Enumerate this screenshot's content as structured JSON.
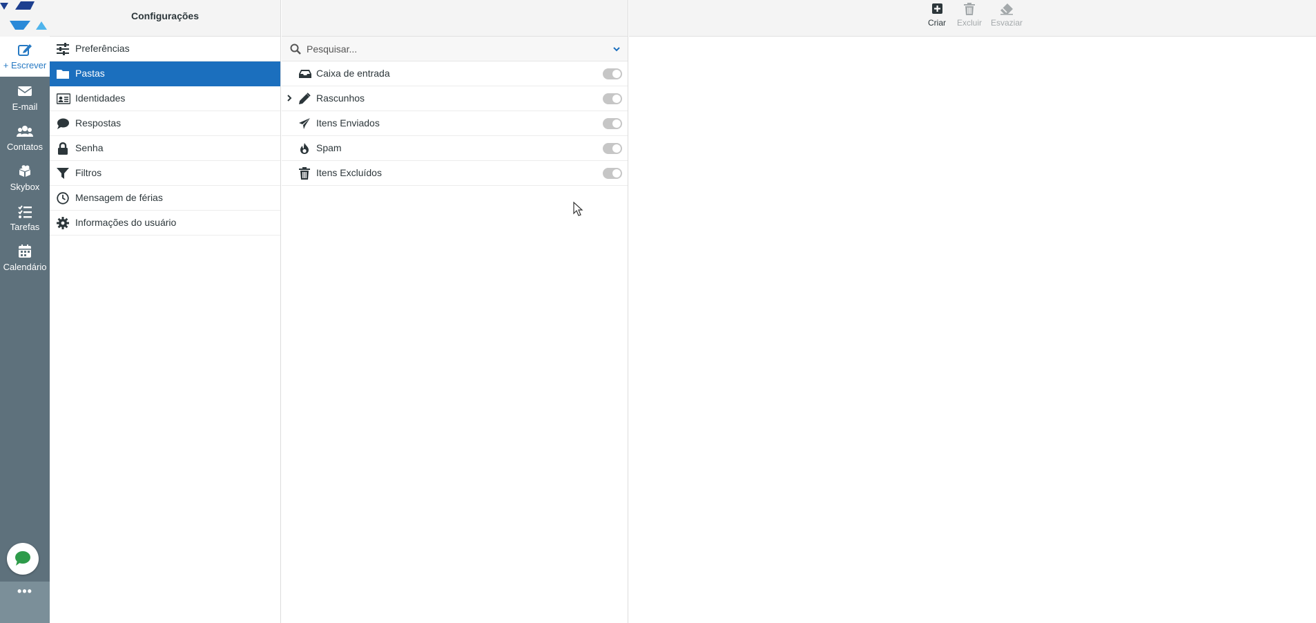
{
  "rail": {
    "items": [
      {
        "label": "+ Escrever",
        "icon": "compose-icon"
      },
      {
        "label": "E-mail",
        "icon": "envelope-icon"
      },
      {
        "label": "Contatos",
        "icon": "users-icon"
      },
      {
        "label": "Skybox",
        "icon": "cloud-box-icon"
      },
      {
        "label": "Tarefas",
        "icon": "tasks-icon"
      },
      {
        "label": "Calendário",
        "icon": "calendar-icon"
      }
    ],
    "more": "•••"
  },
  "settings": {
    "title": "Configurações",
    "items": [
      {
        "label": "Preferências",
        "icon": "sliders-icon"
      },
      {
        "label": "Pastas",
        "icon": "folder-icon",
        "active": true
      },
      {
        "label": "Identidades",
        "icon": "id-card-icon"
      },
      {
        "label": "Respostas",
        "icon": "comment-icon"
      },
      {
        "label": "Senha",
        "icon": "lock-icon"
      },
      {
        "label": "Filtros",
        "icon": "filter-icon"
      },
      {
        "label": "Mensagem de férias",
        "icon": "clock-icon"
      },
      {
        "label": "Informações do usuário",
        "icon": "gear-icon"
      }
    ]
  },
  "folders": {
    "search_placeholder": "Pesquisar...",
    "items": [
      {
        "label": "Caixa de entrada",
        "icon": "inbox-icon",
        "subscribed": true
      },
      {
        "label": "Rascunhos",
        "icon": "pencil-icon",
        "subscribed": true,
        "expandable": true
      },
      {
        "label": "Itens Enviados",
        "icon": "paper-plane-icon",
        "subscribed": true
      },
      {
        "label": "Spam",
        "icon": "fire-icon",
        "subscribed": true
      },
      {
        "label": "Itens Excluídos",
        "icon": "trash-icon",
        "subscribed": true
      }
    ]
  },
  "toolbar": {
    "create": "Criar",
    "delete": "Excluir",
    "empty": "Esvaziar"
  },
  "colors": {
    "rail": "#5e717c",
    "active": "#1b6fbe",
    "accent": "#2679c3"
  }
}
